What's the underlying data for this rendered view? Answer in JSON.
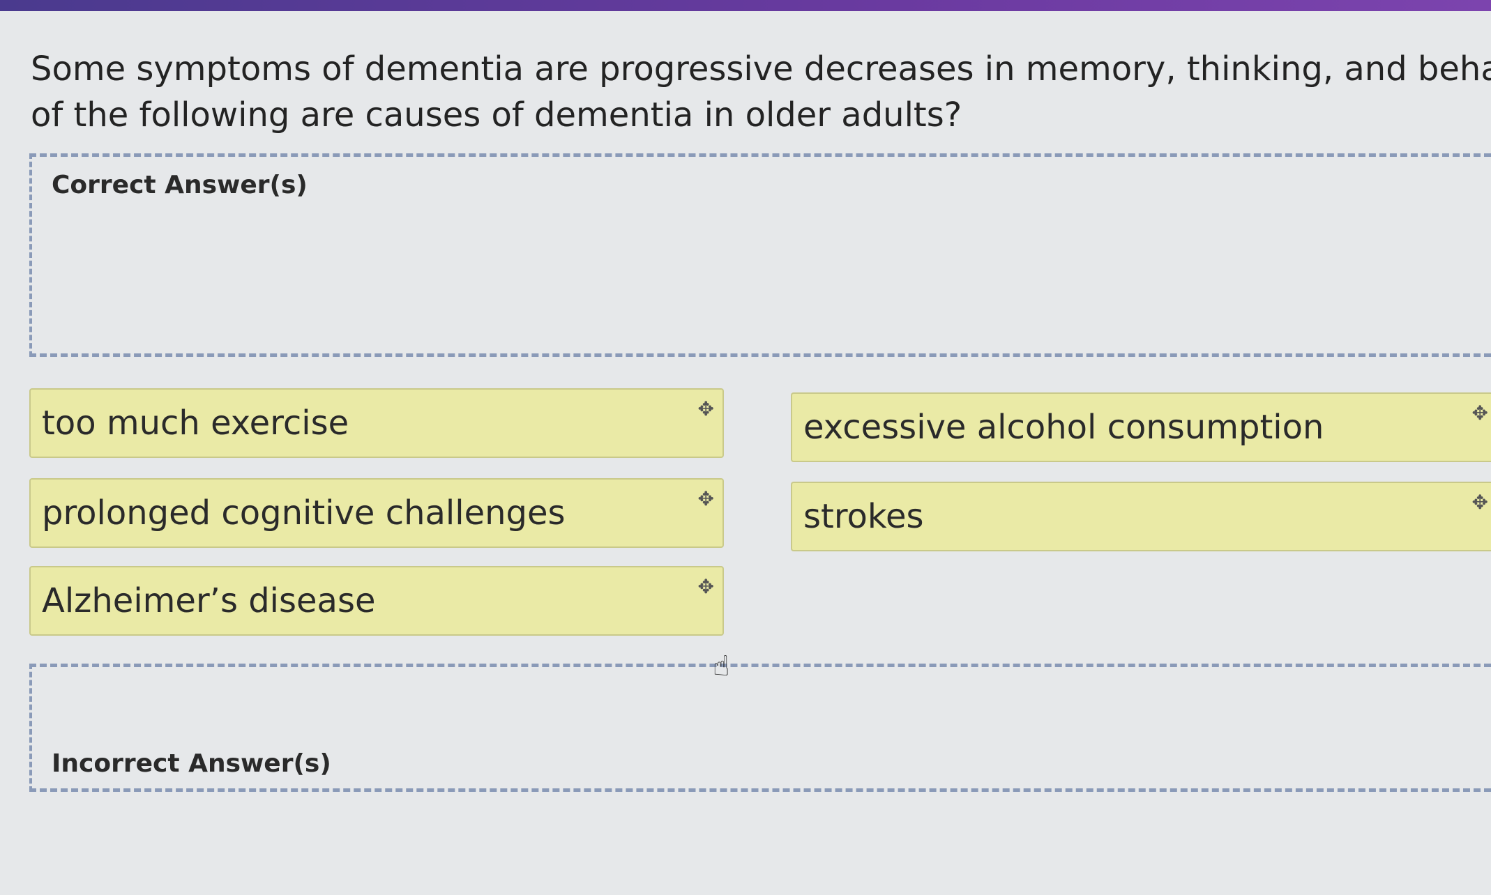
{
  "question": {
    "line1": "Some symptoms of dementia are progressive decreases in memory, thinking, and behavior. Whic",
    "line2": "of the following are causes of dementia in older adults?"
  },
  "zones": {
    "correct_label": "Correct Answer(s)",
    "incorrect_label": "Incorrect Answer(s)"
  },
  "options": [
    {
      "label": "too much exercise",
      "icon": "move-icon"
    },
    {
      "label": "excessive alcohol consumption",
      "icon": "move-icon"
    },
    {
      "label": "prolonged cognitive challenges",
      "icon": "move-icon"
    },
    {
      "label": "strokes",
      "icon": "move-icon"
    },
    {
      "label": "Alzheimer’s disease",
      "icon": "move-icon"
    }
  ],
  "icons": {
    "drag_glyph": "✥",
    "cursor_glyph": "☝"
  },
  "colors": {
    "top_bar": "#6a3aa0",
    "option_bg": "#eaeaa6",
    "zone_border": "#8a9ab8"
  }
}
